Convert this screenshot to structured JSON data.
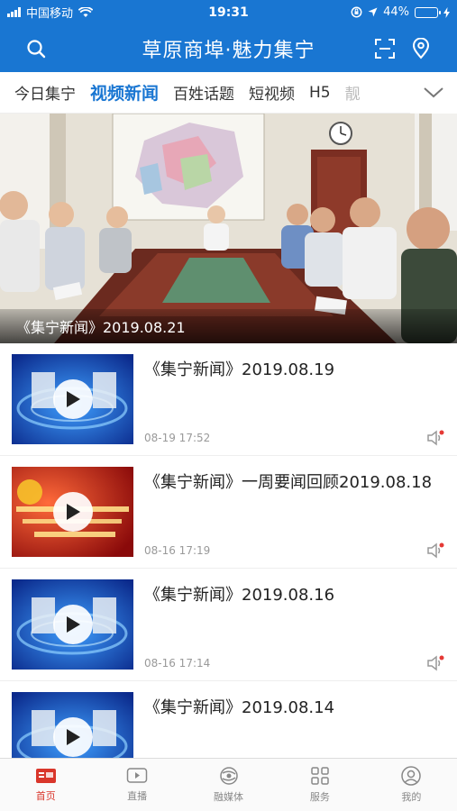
{
  "status_bar": {
    "carrier": "中国移动",
    "time": "19:31",
    "battery_percent": "44%",
    "battery_level": 0.44
  },
  "header": {
    "title": "草原商埠·魅力集宁",
    "icons": [
      "search-icon",
      "scan-icon",
      "location-icon"
    ]
  },
  "tabs": [
    {
      "label": "今日集宁",
      "active": false
    },
    {
      "label": "视频新闻",
      "active": true
    },
    {
      "label": "百姓话题",
      "active": false
    },
    {
      "label": "短视频",
      "active": false
    },
    {
      "label": "H5",
      "active": false
    },
    {
      "label": "靓",
      "active": false
    }
  ],
  "hero": {
    "caption": "《集宁新闻》2019.08.21"
  },
  "news": [
    {
      "title": "《集宁新闻》2019.08.19",
      "date": "08-19 17:52",
      "thumb": "blue"
    },
    {
      "title": "《集宁新闻》一周要闻回顾2019.08.18",
      "date": "08-16 17:19",
      "thumb": "red"
    },
    {
      "title": "《集宁新闻》2019.08.16",
      "date": "08-16 17:14",
      "thumb": "blue"
    },
    {
      "title": "《集宁新闻》2019.08.14",
      "date": "",
      "thumb": "blue"
    }
  ],
  "bottom_nav": [
    {
      "label": "首页",
      "icon": "home-icon",
      "active": true
    },
    {
      "label": "直播",
      "icon": "live-icon",
      "active": false
    },
    {
      "label": "融媒体",
      "icon": "media-icon",
      "active": false
    },
    {
      "label": "服务",
      "icon": "grid-icon",
      "active": false
    },
    {
      "label": "我的",
      "icon": "user-icon",
      "active": false
    }
  ],
  "colors": {
    "brand": "#1976d2",
    "active_nav": "#d9362b"
  }
}
